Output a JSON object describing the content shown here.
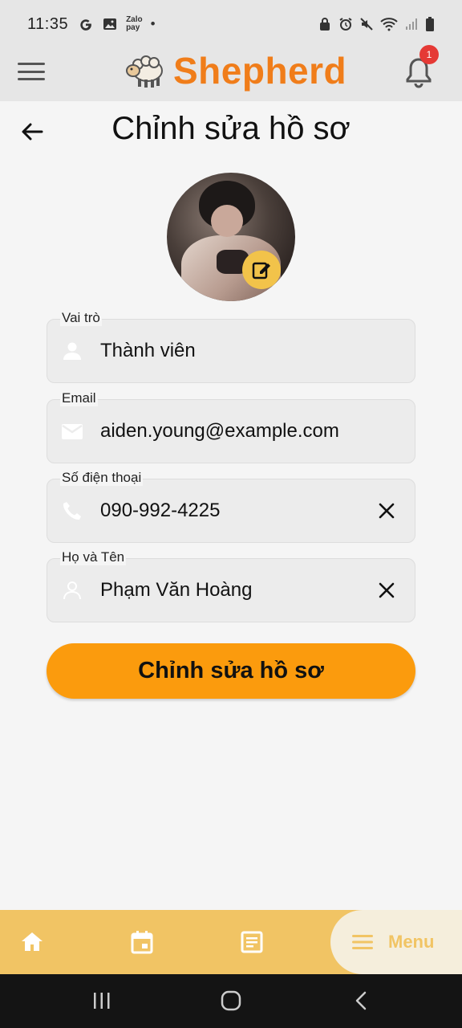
{
  "status_bar": {
    "time": "11:35",
    "zalo_line1": "Zalo",
    "zalo_line2": "pay",
    "dot": "•"
  },
  "app_bar": {
    "brand_name": "Shepherd",
    "notification_count": "1",
    "brand_color": "#f07d1a"
  },
  "page": {
    "title": "Chỉnh sửa hồ sơ"
  },
  "form": {
    "role": {
      "label": "Vai trò",
      "value": "Thành viên",
      "icon": "person-icon"
    },
    "email": {
      "label": "Email",
      "value": "aiden.young@example.com",
      "icon": "mail-icon"
    },
    "phone": {
      "label": "Số điện thoại",
      "value": "090-992-4225",
      "icon": "phone-icon"
    },
    "name": {
      "label": "Họ và Tên",
      "value": "Phạm Văn Hoàng",
      "icon": "person-outline-icon"
    }
  },
  "submit_label": "Chỉnh sửa hồ sơ",
  "bottom_nav": {
    "items": [
      "home-icon",
      "calendar-icon",
      "notes-icon"
    ],
    "menu_label": "Menu",
    "bar_color": "#f1c464"
  },
  "accent_color": "#fb9b0d"
}
